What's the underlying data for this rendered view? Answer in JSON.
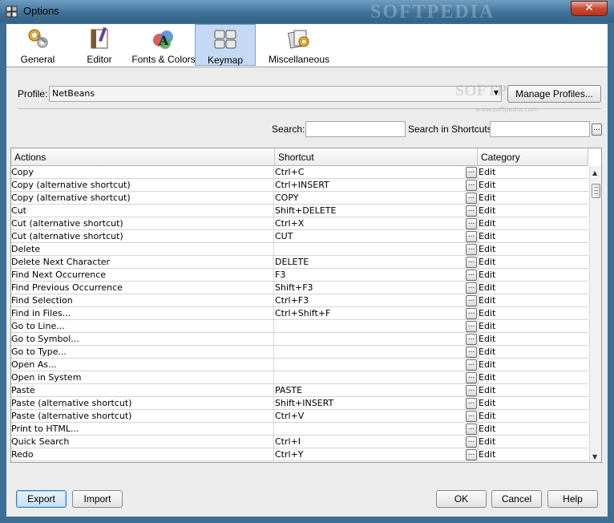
{
  "window": {
    "title": "Options",
    "watermark": "SOFTPEDIA",
    "close_label": "✕"
  },
  "categories": [
    {
      "label": "General",
      "icon": "gears-icon"
    },
    {
      "label": "Editor",
      "icon": "editor-icon"
    },
    {
      "label": "Fonts & Colors",
      "icon": "fonts-colors-icon"
    },
    {
      "label": "Keymap",
      "icon": "keymap-icon",
      "selected": true
    },
    {
      "label": "Miscellaneous",
      "icon": "misc-icon"
    }
  ],
  "profile": {
    "label": "Profile:",
    "value": "NetBeans",
    "manage_label": "Manage Profiles..."
  },
  "softpedia_watermark": {
    "brand": "SOFTPEDIA",
    "url": "www.softpedia.com"
  },
  "search": {
    "label": "Search:",
    "value": "",
    "shortcuts_label": "Search in Shortcuts:",
    "shortcuts_value": "",
    "browse_label": "..."
  },
  "table": {
    "headers": {
      "actions": "Actions",
      "shortcut": "Shortcut",
      "category": "Category"
    },
    "edit_button_label": "...",
    "rows": [
      {
        "action": "Copy",
        "shortcut": "Ctrl+C",
        "category": "Edit"
      },
      {
        "action": "Copy (alternative shortcut)",
        "shortcut": "Ctrl+INSERT",
        "category": "Edit"
      },
      {
        "action": "Copy (alternative shortcut)",
        "shortcut": "COPY",
        "category": "Edit"
      },
      {
        "action": "Cut",
        "shortcut": "Shift+DELETE",
        "category": "Edit"
      },
      {
        "action": "Cut (alternative shortcut)",
        "shortcut": "Ctrl+X",
        "category": "Edit"
      },
      {
        "action": "Cut (alternative shortcut)",
        "shortcut": "CUT",
        "category": "Edit"
      },
      {
        "action": "Delete",
        "shortcut": "",
        "category": "Edit"
      },
      {
        "action": "Delete Next Character",
        "shortcut": "DELETE",
        "category": "Edit"
      },
      {
        "action": "Find Next Occurrence",
        "shortcut": "F3",
        "category": "Edit"
      },
      {
        "action": "Find Previous Occurrence",
        "shortcut": "Shift+F3",
        "category": "Edit"
      },
      {
        "action": "Find Selection",
        "shortcut": "Ctrl+F3",
        "category": "Edit"
      },
      {
        "action": "Find in Files...",
        "shortcut": "Ctrl+Shift+F",
        "category": "Edit"
      },
      {
        "action": "Go to Line...",
        "shortcut": "",
        "category": "Edit"
      },
      {
        "action": "Go to Symbol...",
        "shortcut": "",
        "category": "Edit"
      },
      {
        "action": "Go to Type...",
        "shortcut": "",
        "category": "Edit"
      },
      {
        "action": "Open As...",
        "shortcut": "",
        "category": "Edit"
      },
      {
        "action": "Open in System",
        "shortcut": "",
        "category": "Edit"
      },
      {
        "action": "Paste",
        "shortcut": "PASTE",
        "category": "Edit"
      },
      {
        "action": "Paste (alternative shortcut)",
        "shortcut": "Shift+INSERT",
        "category": "Edit"
      },
      {
        "action": "Paste (alternative shortcut)",
        "shortcut": "Ctrl+V",
        "category": "Edit"
      },
      {
        "action": "Print to HTML...",
        "shortcut": "",
        "category": "Edit"
      },
      {
        "action": "Quick Search",
        "shortcut": "Ctrl+I",
        "category": "Edit"
      },
      {
        "action": "Redo",
        "shortcut": "Ctrl+Y",
        "category": "Edit"
      }
    ]
  },
  "buttons": {
    "export": "Export",
    "import": "Import",
    "ok": "OK",
    "cancel": "Cancel",
    "help": "Help"
  }
}
